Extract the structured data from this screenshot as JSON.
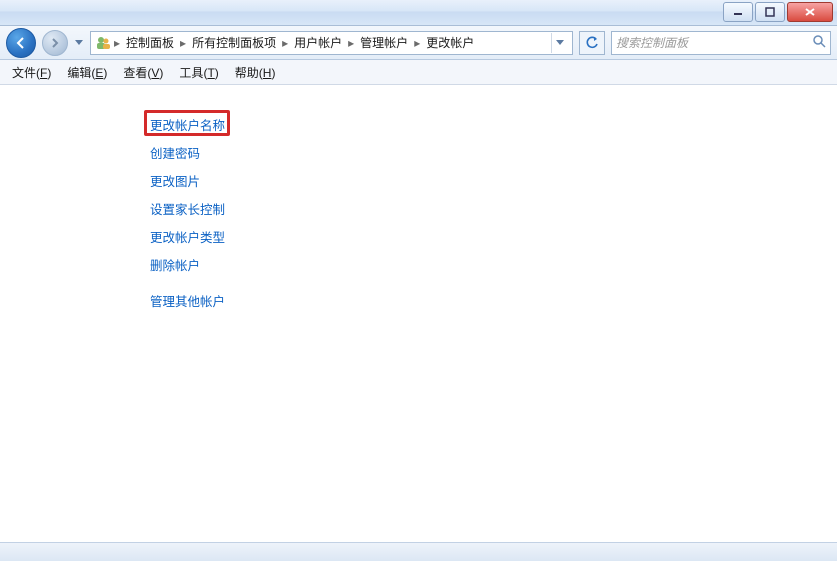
{
  "titlebar": {
    "min_tip": "最小化",
    "max_tip": "最大化",
    "close_tip": "关闭"
  },
  "nav": {
    "breadcrumbs": [
      "控制面板",
      "所有控制面板项",
      "用户帐户",
      "管理帐户",
      "更改帐户"
    ]
  },
  "search": {
    "placeholder": "搜索控制面板"
  },
  "menus": {
    "file": {
      "label": "文件",
      "hot": "F"
    },
    "edit": {
      "label": "编辑",
      "hot": "E"
    },
    "view": {
      "label": "查看",
      "hot": "V"
    },
    "tools": {
      "label": "工具",
      "hot": "T"
    },
    "help": {
      "label": "帮助",
      "hot": "H"
    }
  },
  "links": {
    "rename": "更改帐户名称",
    "create_pw": "创建密码",
    "change_pic": "更改图片",
    "parental": "设置家长控制",
    "change_type": "更改帐户类型",
    "delete": "删除帐户",
    "manage_other": "管理其他帐户"
  }
}
